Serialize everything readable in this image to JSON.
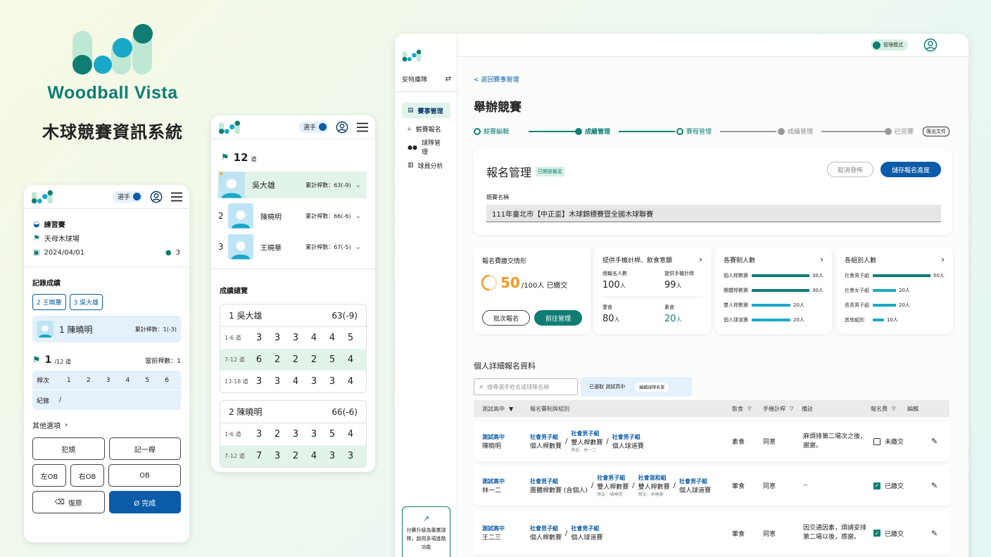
{
  "brand": {
    "name": "Woodball Vista",
    "subtitle": "木球競賽資訊系統"
  },
  "colors": {
    "teal": "#0f7d73",
    "blue": "#0a5ca8",
    "cyan": "#1aa8c9",
    "mint": "#bfe8d4",
    "light_teal_row": "#e2f4ea"
  },
  "phone_left": {
    "role_toggle": "選手",
    "event_type": "練習賽",
    "venue": "天母木球場",
    "date": "2024/04/01",
    "player_count": "3",
    "record_title": "記錄成績",
    "player_chips": [
      "2 王曉華",
      "3 吳大雄"
    ],
    "current_player": "1 陳曉明",
    "current_total": "累計桿數：1(-3)",
    "hole_num": "1",
    "hole_total": "/12 道",
    "current_strokes": "當前桿數：1",
    "stroke_header": "桿次",
    "strokes": [
      "1",
      "2",
      "3",
      "4",
      "5",
      "6"
    ],
    "record_label": "紀錄",
    "record_value": "/",
    "other_options": "其他選項",
    "buttons": {
      "foul": "犯規",
      "one_stroke": "記一桿",
      "left_ob": "左OB",
      "right_ob": "右OB",
      "ob": "OB",
      "restore": "復原",
      "done": "Ø 完成"
    }
  },
  "phone_mid": {
    "role_toggle": "選手",
    "hole_count": "12",
    "hole_unit": "道",
    "ranking": [
      {
        "rank": "1",
        "name": "吳大雄",
        "total": "累計桿數：63(-9)"
      },
      {
        "rank": "2",
        "name": "陳曉明",
        "total": "累計桿數：66(-6)"
      },
      {
        "rank": "3",
        "name": "王曉華",
        "total": "累計桿數：67(-5)"
      }
    ],
    "overview_title": "成績總覽",
    "players": [
      {
        "name": "1 吳大雄",
        "score": "63(-9)",
        "rows": [
          {
            "label": "1-6 道",
            "vals": [
              "3",
              "3",
              "3",
              "4",
              "4",
              "5"
            ]
          },
          {
            "label": "7-12 道",
            "vals": [
              "6",
              "2",
              "2",
              "2",
              "5",
              "4"
            ]
          },
          {
            "label": "13-18 道",
            "vals": [
              "3",
              "3",
              "4",
              "3",
              "3",
              "4"
            ]
          }
        ]
      },
      {
        "name": "2 陳曉明",
        "score": "66(-6)",
        "rows": [
          {
            "label": "1-6 道",
            "vals": [
              "3",
              "2",
              "3",
              "3",
              "5",
              "4"
            ]
          },
          {
            "label": "7-12 道",
            "vals": [
              "7",
              "3",
              "2",
              "4",
              "3",
              "3"
            ]
          }
        ]
      }
    ]
  },
  "desktop": {
    "admin_mode": "管理模式",
    "team_name": "安特庫隊",
    "sidebar": [
      "賽事管理",
      "競賽報名",
      "球隊管理",
      "球員分析"
    ],
    "upgrade_text": "付費升級為專業球隊，啟用多項進階功能",
    "back_link": "< 返回賽事管理",
    "page_title": "舉辦競賽",
    "steps": [
      "競賽編輯",
      "成績管理",
      "賽程管理",
      "成績管理",
      "已完賽"
    ],
    "export_btn": "匯出文件",
    "reg_panel": {
      "title": "報名管理",
      "badge": "已開放報名",
      "cancel": "取消發佈",
      "save": "儲存報名進度",
      "name_label": "競賽名稱",
      "name_value": "111年臺北市【中正盃】木球錦標賽暨全國木球聯賽"
    },
    "fee_card": {
      "title": "報名費繳交情形",
      "paid": "50",
      "suffix": "/100人 已繳交",
      "paid_fraction": 0.5,
      "batch_btn": "批次報名",
      "manage_btn": "前往管理"
    },
    "equip_card": {
      "title": "提供手機計桿、飲食意願",
      "cells": [
        {
          "label": "總報名人數",
          "value": "100",
          "unit": "人"
        },
        {
          "label": "提供手機計桿",
          "value": "99",
          "unit": "人"
        },
        {
          "label": "葷食",
          "value": "80",
          "unit": "人"
        },
        {
          "label": "素食",
          "value": "20",
          "unit": "人"
        }
      ]
    },
    "comp_card": {
      "title": "各賽制人數",
      "rows": [
        {
          "name": "個人桿數賽",
          "count": "30人",
          "value": 30
        },
        {
          "name": "團體桿數賽",
          "count": "30人",
          "value": 30
        },
        {
          "name": "雙人桿數賽",
          "count": "20人",
          "value": 20
        },
        {
          "name": "個人球道賽",
          "count": "20人",
          "value": 20
        }
      ]
    },
    "group_card": {
      "title": "各組別人數",
      "rows": [
        {
          "name": "社會男子組",
          "count": "50人",
          "value": 50
        },
        {
          "name": "社會女子組",
          "count": "20人",
          "value": 20
        },
        {
          "name": "長青男子組",
          "count": "20人",
          "value": 20
        },
        {
          "name": "其他組別",
          "count": "10人",
          "value": 10
        }
      ]
    },
    "detail_title": "個人詳細報名資料",
    "search_placeholder": "搜尋選手姓名或球隊名稱",
    "filter_selected": "已選取 測試高中",
    "edit_team_btn": "編輯球隊名單",
    "table_headers": [
      "測試高中",
      "報名賽制與組別",
      "飲食",
      "手機計桿",
      "備註",
      "報名費",
      "編輯"
    ],
    "rows": [
      {
        "team": "測試高中",
        "name": "陳曉明",
        "cats": [
          {
            "label": "社會男子組",
            "val": "個人桿數賽",
            "sub": ""
          },
          {
            "label": "社會男子組",
            "val": "雙人桿數賽",
            "sub": "隊友：林一二"
          },
          {
            "label": "社會男子組",
            "val": "個人球道賽",
            "sub": ""
          }
        ],
        "diet": "素食",
        "phone": "同意",
        "note": "麻煩排第二場次之後，謝謝。",
        "fee": "未繳交",
        "paid": false
      },
      {
        "team": "測試高中",
        "name": "林一二",
        "cats": [
          {
            "label": "社會男子組",
            "val": "團體桿數賽 (含個人)",
            "sub": ""
          },
          {
            "label": "社會男子組",
            "val": "雙人桿數賽",
            "sub": "隊友：陳曉明"
          },
          {
            "label": "社會混和組",
            "val": "雙人桿數賽",
            "sub": "隊友：林曉華"
          },
          {
            "label": "社會男子組",
            "val": "個人球道賽",
            "sub": ""
          }
        ],
        "diet": "葷食",
        "phone": "同意",
        "note": "--",
        "fee": "已繳交",
        "paid": true
      },
      {
        "team": "測試高中",
        "name": "王二三",
        "cats": [
          {
            "label": "社會男子組",
            "val": "個人桿數賽",
            "sub": ""
          },
          {
            "label": "社會男子組",
            "val": "個人球道賽",
            "sub": ""
          }
        ],
        "diet": "葷食",
        "phone": "同意",
        "note": "因交通因素，煩請安排第二場以後，感謝。",
        "fee": "已繳交",
        "paid": true
      }
    ]
  }
}
